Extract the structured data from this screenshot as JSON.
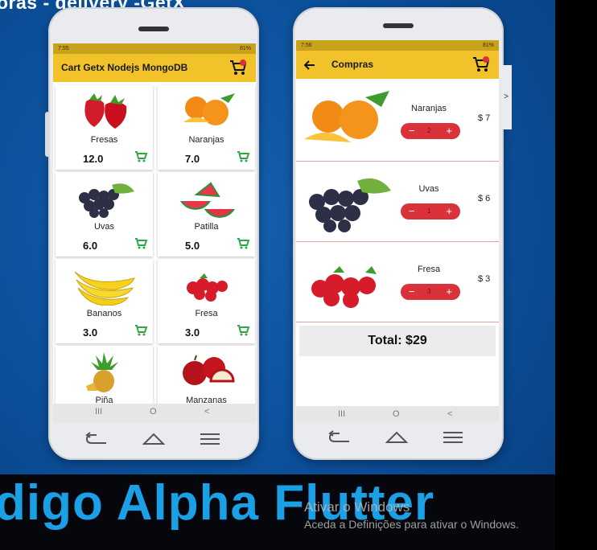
{
  "video": {
    "title": "oras - delivery -GetX",
    "brand": "digo Alpha Flutter",
    "watermark_title": "Ativar o Windows",
    "watermark_sub": "Aceda a Definições para ativar o Windows."
  },
  "phone1": {
    "status_time": "7:55",
    "status_right": "81%",
    "app_title": "Cart Getx Nodejs MongoDB",
    "products": [
      {
        "name": "Fresas",
        "price": "12.0",
        "icon": "strawberry-image"
      },
      {
        "name": "Naranjas",
        "price": "7.0",
        "icon": "orange-image"
      },
      {
        "name": "Uvas",
        "price": "6.0",
        "icon": "grapes-image"
      },
      {
        "name": "Patilla",
        "price": "5.0",
        "icon": "watermelon-image"
      },
      {
        "name": "Bananos",
        "price": "3.0",
        "icon": "banana-image"
      },
      {
        "name": "Fresa",
        "price": "3.0",
        "icon": "strawberry-image"
      },
      {
        "name": "Piña",
        "price": "",
        "icon": "pineapple-image"
      },
      {
        "name": "Manzanas",
        "price": "",
        "icon": "apple-image"
      }
    ]
  },
  "phone2": {
    "status_time": "7:56",
    "status_right": "81%",
    "app_title": "Compras",
    "items": [
      {
        "name": "Naranjas",
        "qty": "2",
        "cost": "$ 7"
      },
      {
        "name": "Uvas",
        "qty": "1",
        "cost": "$ 6"
      },
      {
        "name": "Fresa",
        "qty": "3",
        "cost": "$ 3"
      }
    ],
    "total": "Total: $29"
  },
  "nav": {
    "recents": "III",
    "home": "O",
    "back": "<"
  },
  "colors": {
    "appbar": "#f1c229",
    "accent_red": "#d9323a",
    "cart_green": "#2fa84a",
    "brand_blue": "#1ba0e6"
  }
}
